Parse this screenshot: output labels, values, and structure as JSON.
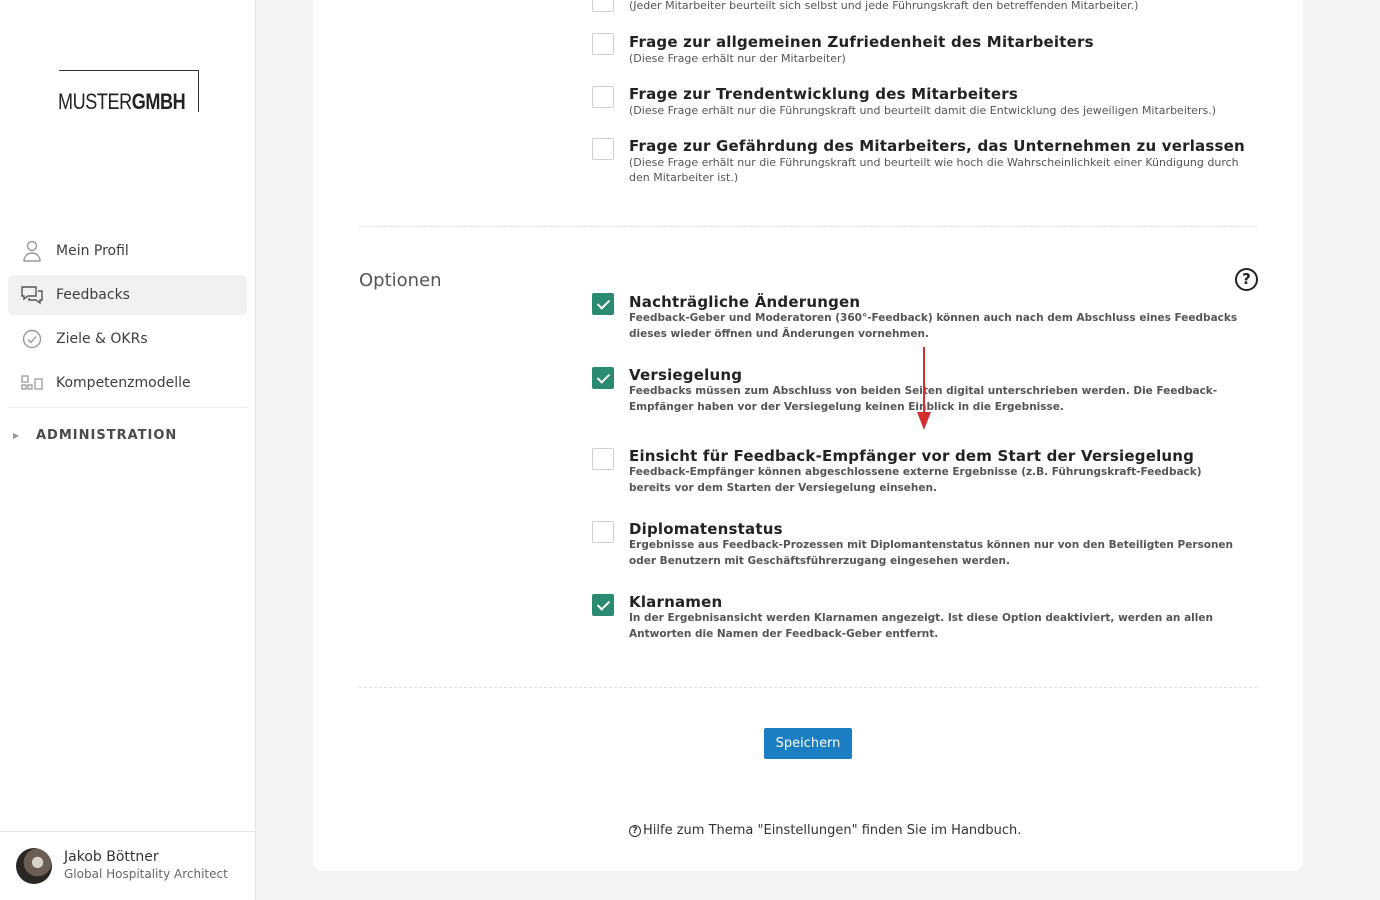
{
  "logo": {
    "part1": "MUSTER",
    "part2": "GMBH"
  },
  "nav": {
    "items": [
      {
        "label": "Mein Profil",
        "icon": "person-icon"
      },
      {
        "label": "Feedbacks",
        "icon": "chat-bubbles-icon"
      },
      {
        "label": "Ziele & OKRs",
        "icon": "check-circle-icon"
      },
      {
        "label": "Kompetenzmodelle",
        "icon": "competency-model-icon"
      }
    ],
    "admin": "ADMINISTRATION"
  },
  "user": {
    "name": "Jakob Böttner",
    "role": "Global Hospitality Architect"
  },
  "questions": [
    {
      "desc": "(Jeder Mitarbeiter beurteilt sich selbst und jede Führungskraft den betreffenden Mitarbeiter.)"
    },
    {
      "title": "Frage zur allgemeinen Zufriedenheit des Mitarbeiters",
      "desc": "(Diese Frage erhält nur der Mitarbeiter)",
      "checked": false
    },
    {
      "title": "Frage zur Trendentwicklung des Mitarbeiters",
      "desc": "(Diese Frage erhält nur die Führungskraft und beurteilt damit die Entwicklung des jeweiligen Mitarbeiters.)",
      "checked": false
    },
    {
      "title": "Frage zur Gefährdung des Mitarbeiters, das Unternehmen zu verlassen",
      "desc": "(Diese Frage erhält nur die Führungskraft und beurteilt wie hoch die Wahrscheinlichkeit einer Kündigung durch den Mitarbeiter ist.)",
      "checked": false
    }
  ],
  "options": {
    "label": "Optionen",
    "help": "?",
    "items": [
      {
        "title": "Nachträgliche Änderungen",
        "desc": "Feedback-Geber und Moderatoren (360°-Feedback) können auch nach dem Abschluss eines Feedbacks dieses wieder öffnen und Änderungen vornehmen.",
        "checked": true
      },
      {
        "title": "Versiegelung",
        "desc": "Feedbacks müssen zum Abschluss von beiden Seiten digital unterschrieben werden. Die Feedback-Empfänger haben vor der Versiegelung keinen Einblick in die Ergebnisse.",
        "checked": true
      },
      {
        "title": "Einsicht für Feedback-Empfänger vor dem Start der Versiegelung",
        "desc": "Feedback-Empfänger können abgeschlossene externe Ergebnisse (z.B. Führungskraft-Feedback) bereits vor dem Starten der Versiegelung einsehen.",
        "checked": false
      },
      {
        "title": "Diplomatenstatus",
        "desc": "Ergebnisse aus Feedback-Prozessen mit Diplomantenstatus können nur von den Beteiligten Personen oder Benutzern mit Geschäftsführerzugang eingesehen werden.",
        "checked": false
      },
      {
        "title": "Klarnamen",
        "desc": "In der Ergebnisansicht werden Klarnamen angezeigt. Ist diese Option deaktiviert, werden an allen Antworten die Namen der Feedback-Geber entfernt.",
        "checked": true
      }
    ]
  },
  "save_label": "Speichern",
  "help_text": "Hilfe zum Thema \"Einstellungen\" finden Sie im Handbuch.",
  "colors": {
    "accent": "#2a8a72",
    "button": "#1b7ec2",
    "arrow": "#d32f2f"
  }
}
